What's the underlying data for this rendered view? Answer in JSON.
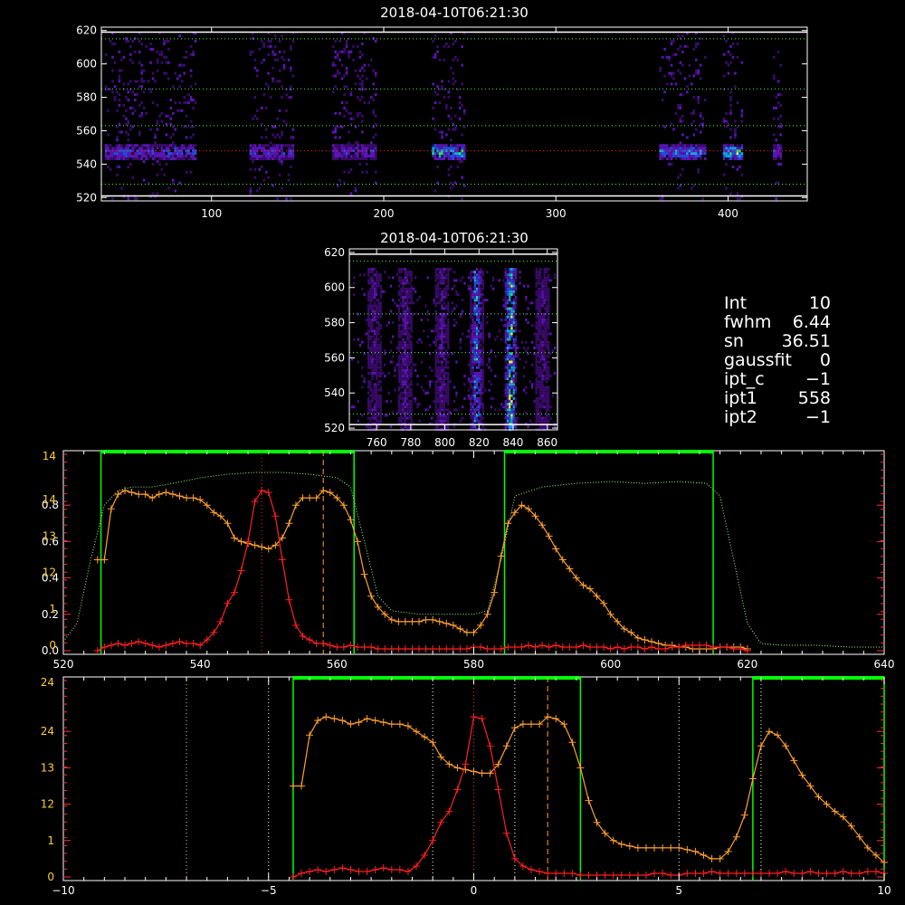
{
  "colors": {
    "background": "#000000",
    "axis": "#ffffff",
    "red_trace": "#ff2020",
    "orange_trace": "#ffa030",
    "green_box": "#00ff00",
    "light_green_dotted": "#a0ff80",
    "red_tick": "#ff3030",
    "gold_tick": "#ffcc33"
  },
  "info_panel": {
    "lines": [
      {
        "label": "Int",
        "value": "10"
      },
      {
        "label": "fwhm",
        "value": "6.44"
      },
      {
        "label": "sn",
        "value": "36.51"
      },
      {
        "label": "gaussfit",
        "value": "0"
      },
      {
        "label": "ipt_c",
        "value": "−1"
      },
      {
        "label": "ipt1",
        "value": "558"
      },
      {
        "label": "ipt2",
        "value": "−1"
      }
    ]
  },
  "chart_data": [
    {
      "type": "heatmap",
      "title": "2018-04-10T06:21:30",
      "xlabel": "",
      "ylabel": "",
      "xlim": [
        36,
        446
      ],
      "ylim": [
        518,
        622
      ],
      "x_ticks": [
        100,
        200,
        300,
        400
      ],
      "y_ticks": [
        520,
        540,
        560,
        580,
        600,
        620
      ],
      "colormap": "dark-purple-blue-green-yellow",
      "reference_lines_y": [
        {
          "y": 548,
          "style": "red-dotted"
        },
        {
          "y": 528,
          "style": "green-dotted"
        },
        {
          "y": 563,
          "style": "green-dotted"
        },
        {
          "y": 585,
          "style": "green-dotted"
        },
        {
          "y": 615,
          "style": "green-dotted"
        }
      ],
      "bands": [
        {
          "x": [
            38,
            90
          ],
          "core": 548,
          "intensity": 0.55
        },
        {
          "x": [
            122,
            148
          ],
          "core": 548,
          "intensity": 0.5
        },
        {
          "x": [
            170,
            195
          ],
          "core": 548,
          "intensity": 0.45
        },
        {
          "x": [
            228,
            247
          ],
          "core": 548,
          "intensity": 0.8
        },
        {
          "x": [
            360,
            387
          ],
          "core": 548,
          "intensity": 0.65
        },
        {
          "x": [
            397,
            408
          ],
          "core": 548,
          "intensity": 0.85
        },
        {
          "x": [
            426,
            430
          ],
          "core": 548,
          "intensity": 0.5
        }
      ]
    },
    {
      "type": "heatmap",
      "title": "2018-04-10T06:21:30",
      "xlabel": "",
      "ylabel": "",
      "xlim": [
        744,
        866
      ],
      "ylim": [
        519,
        622
      ],
      "x_ticks": [
        760,
        780,
        800,
        820,
        840,
        860
      ],
      "y_ticks": [
        520,
        540,
        560,
        580,
        600,
        620
      ],
      "colormap": "dark-purple-blue-green-yellow",
      "reference_lines_y": [
        {
          "y": 615,
          "style": "green-dotted"
        },
        {
          "y": 585,
          "style": "green-dotted"
        },
        {
          "y": 563,
          "style": "green-dotted"
        },
        {
          "y": 528,
          "style": "green-dotted"
        }
      ],
      "streaks": [
        {
          "x": 758,
          "intensity": 0.3
        },
        {
          "x": 776,
          "intensity": 0.35
        },
        {
          "x": 798,
          "intensity": 0.35
        },
        {
          "x": 818,
          "intensity": 0.7
        },
        {
          "x": 838,
          "intensity": 0.9
        },
        {
          "x": 857,
          "intensity": 0.3
        }
      ]
    },
    {
      "type": "line",
      "title": "",
      "xlabel": "",
      "ylabel": "",
      "xlim": [
        520,
        640
      ],
      "ylim": [
        0,
        1.0
      ],
      "left_ticks_white": [
        "0.0",
        "0.2",
        "0.4",
        "0.6",
        "0.8"
      ],
      "left_ticks_red": [
        "0",
        "1",
        "12",
        "13",
        "14"
      ],
      "x_ticks": [
        520,
        540,
        560,
        580,
        600,
        620,
        640
      ],
      "green_boxes": [
        [
          525.5,
          562.5
        ],
        [
          584.5,
          615.0
        ]
      ],
      "vertical_markers": [
        {
          "x": 549.0,
          "style": "red-dotted"
        },
        {
          "x": 558.0,
          "style": "orange-dashed"
        }
      ],
      "series": [
        {
          "style": "light-green-dotted",
          "x": [
            520,
            522,
            524,
            526,
            528,
            530,
            533,
            536,
            540,
            544,
            548,
            552,
            556,
            560,
            562,
            564,
            566,
            568,
            572,
            576,
            580,
            582,
            584,
            586,
            590,
            595,
            600,
            605,
            610,
            614,
            616,
            618,
            620,
            622,
            625,
            630,
            635,
            640
          ],
          "y": [
            0.05,
            0.15,
            0.5,
            0.8,
            0.88,
            0.9,
            0.9,
            0.92,
            0.95,
            0.97,
            0.98,
            0.98,
            0.97,
            0.95,
            0.9,
            0.6,
            0.3,
            0.22,
            0.2,
            0.2,
            0.2,
            0.22,
            0.5,
            0.85,
            0.9,
            0.92,
            0.93,
            0.92,
            0.93,
            0.92,
            0.85,
            0.5,
            0.15,
            0.04,
            0.03,
            0.03,
            0.02,
            0.02
          ]
        },
        {
          "style": "orange-plus",
          "x": [
            525,
            526,
            527,
            528,
            529,
            530,
            531,
            532,
            533,
            534,
            535,
            536,
            537,
            538,
            539,
            540,
            541,
            542,
            543,
            544,
            545,
            546,
            547,
            548,
            549,
            550,
            551,
            552,
            553,
            554,
            555,
            556,
            557,
            558,
            559,
            560,
            561,
            562,
            563,
            564,
            565,
            566,
            567,
            568,
            569,
            570,
            571,
            572,
            573,
            574,
            575,
            576,
            577,
            578,
            579,
            580,
            581,
            582,
            583,
            584,
            585,
            586,
            587,
            588,
            589,
            590,
            591,
            592,
            593,
            594,
            595,
            596,
            597,
            598,
            599,
            600,
            601,
            602,
            603,
            604,
            605,
            606,
            607,
            608,
            609,
            610,
            611,
            612,
            613,
            614,
            615,
            616,
            617,
            618,
            619,
            620
          ],
          "y": [
            0.5,
            0.5,
            0.78,
            0.86,
            0.88,
            0.87,
            0.86,
            0.86,
            0.84,
            0.86,
            0.87,
            0.86,
            0.85,
            0.84,
            0.84,
            0.83,
            0.8,
            0.76,
            0.74,
            0.7,
            0.62,
            0.6,
            0.59,
            0.58,
            0.57,
            0.56,
            0.58,
            0.62,
            0.7,
            0.8,
            0.84,
            0.84,
            0.84,
            0.88,
            0.87,
            0.84,
            0.8,
            0.72,
            0.6,
            0.42,
            0.3,
            0.24,
            0.2,
            0.17,
            0.16,
            0.16,
            0.16,
            0.16,
            0.17,
            0.17,
            0.16,
            0.15,
            0.14,
            0.12,
            0.1,
            0.1,
            0.14,
            0.2,
            0.32,
            0.52,
            0.7,
            0.76,
            0.8,
            0.78,
            0.74,
            0.69,
            0.63,
            0.56,
            0.5,
            0.45,
            0.4,
            0.36,
            0.34,
            0.3,
            0.26,
            0.2,
            0.16,
            0.12,
            0.1,
            0.07,
            0.06,
            0.05,
            0.04,
            0.03,
            0.03,
            0.02,
            0.02,
            0.01,
            0.01,
            0.01,
            0.01,
            0.02,
            0.02,
            0.02,
            0.02,
            0.01
          ]
        },
        {
          "style": "red-plus",
          "x": [
            525,
            526,
            527,
            528,
            529,
            530,
            531,
            532,
            533,
            534,
            535,
            536,
            537,
            538,
            539,
            540,
            541,
            542,
            543,
            544,
            545,
            546,
            547,
            548,
            549,
            550,
            551,
            552,
            553,
            554,
            555,
            556,
            557,
            558,
            559,
            560,
            561,
            562,
            563,
            564,
            565,
            566,
            567,
            568,
            569,
            570,
            571,
            572,
            573,
            574,
            575,
            576,
            577,
            578,
            579,
            580,
            581,
            582,
            583,
            584,
            585,
            586,
            587,
            588,
            589,
            590,
            591,
            592,
            593,
            594,
            595,
            596,
            597,
            598,
            599,
            600,
            601,
            602,
            603,
            604,
            605,
            606,
            607,
            608,
            609,
            610,
            611,
            612,
            613,
            614,
            615,
            616,
            617,
            618,
            619,
            620
          ],
          "y": [
            0.0,
            0.02,
            0.03,
            0.04,
            0.03,
            0.04,
            0.05,
            0.04,
            0.03,
            0.02,
            0.03,
            0.04,
            0.05,
            0.04,
            0.04,
            0.03,
            0.06,
            0.1,
            0.16,
            0.26,
            0.32,
            0.44,
            0.6,
            0.82,
            0.88,
            0.87,
            0.74,
            0.5,
            0.28,
            0.14,
            0.08,
            0.06,
            0.04,
            0.04,
            0.03,
            0.02,
            0.02,
            0.03,
            0.02,
            0.02,
            0.02,
            0.01,
            0.01,
            0.01,
            0.01,
            0.01,
            0.01,
            0.01,
            0.01,
            0.01,
            0.01,
            0.01,
            0.01,
            0.01,
            0.01,
            0.02,
            0.02,
            0.01,
            0.01,
            0.01,
            0.02,
            0.02,
            0.02,
            0.03,
            0.02,
            0.03,
            0.02,
            0.03,
            0.02,
            0.02,
            0.02,
            0.03,
            0.02,
            0.02,
            0.02,
            0.01,
            0.02,
            0.01,
            0.02,
            0.02,
            0.01,
            0.02,
            0.01,
            0.01,
            0.02,
            0.02,
            0.03,
            0.03,
            0.03,
            0.03,
            0.02,
            0.02,
            0.02,
            0.01,
            0.01,
            0.0
          ]
        }
      ]
    },
    {
      "type": "line",
      "title": "",
      "xlabel": "",
      "ylabel": "",
      "xlim": [
        -10,
        10
      ],
      "ylim": [
        0,
        1.0
      ],
      "left_ticks_red": [
        "0",
        "1",
        "12",
        "13",
        "24"
      ],
      "x_ticks": [
        -10,
        -5,
        0,
        5,
        10
      ],
      "green_boxes": [
        [
          -4.4,
          2.6
        ],
        [
          6.8,
          10.0
        ]
      ],
      "vertical_markers": [
        {
          "x": 0.0,
          "style": "red-dotted"
        },
        {
          "x": 1.8,
          "style": "orange-dashed"
        },
        {
          "x": -7.0,
          "style": "gold-dotted"
        },
        {
          "x": -5.0,
          "style": "white-dotted"
        },
        {
          "x": -1.0,
          "style": "white-dotted"
        },
        {
          "x": 1.0,
          "style": "white-dotted"
        },
        {
          "x": 5.0,
          "style": "white-dotted"
        },
        {
          "x": 7.0,
          "style": "white-dotted"
        }
      ],
      "series": [
        {
          "style": "orange-plus",
          "x": [
            -4.4,
            -4.2,
            -4.0,
            -3.8,
            -3.6,
            -3.4,
            -3.2,
            -3.0,
            -2.8,
            -2.6,
            -2.4,
            -2.2,
            -2.0,
            -1.8,
            -1.6,
            -1.4,
            -1.2,
            -1.0,
            -0.8,
            -0.6,
            -0.4,
            -0.2,
            0.0,
            0.2,
            0.4,
            0.6,
            0.8,
            1.0,
            1.2,
            1.4,
            1.6,
            1.8,
            2.0,
            2.2,
            2.4,
            2.6,
            2.8,
            3.0,
            3.2,
            3.4,
            3.6,
            3.8,
            4.0,
            4.2,
            4.4,
            4.6,
            4.8,
            5.0,
            5.2,
            5.4,
            5.6,
            5.8,
            6.0,
            6.2,
            6.4,
            6.6,
            6.8,
            7.0,
            7.2,
            7.4,
            7.6,
            7.8,
            8.0,
            8.2,
            8.4,
            8.6,
            8.8,
            9.0,
            9.2,
            9.4,
            9.6,
            9.8,
            10.0
          ],
          "y": [
            0.5,
            0.5,
            0.78,
            0.86,
            0.88,
            0.87,
            0.86,
            0.84,
            0.85,
            0.87,
            0.86,
            0.85,
            0.84,
            0.84,
            0.83,
            0.8,
            0.77,
            0.74,
            0.66,
            0.62,
            0.6,
            0.59,
            0.58,
            0.57,
            0.57,
            0.62,
            0.72,
            0.82,
            0.84,
            0.84,
            0.84,
            0.88,
            0.87,
            0.84,
            0.74,
            0.6,
            0.42,
            0.3,
            0.24,
            0.2,
            0.18,
            0.17,
            0.16,
            0.16,
            0.16,
            0.16,
            0.16,
            0.16,
            0.15,
            0.14,
            0.12,
            0.1,
            0.1,
            0.14,
            0.22,
            0.34,
            0.54,
            0.72,
            0.8,
            0.78,
            0.72,
            0.64,
            0.56,
            0.5,
            0.44,
            0.4,
            0.36,
            0.33,
            0.28,
            0.22,
            0.16,
            0.12,
            0.08
          ]
        },
        {
          "style": "red-plus",
          "x": [
            -4.4,
            -4.2,
            -4.0,
            -3.8,
            -3.6,
            -3.4,
            -3.2,
            -3.0,
            -2.8,
            -2.6,
            -2.4,
            -2.2,
            -2.0,
            -1.8,
            -1.6,
            -1.4,
            -1.2,
            -1.0,
            -0.8,
            -0.6,
            -0.4,
            -0.2,
            0.0,
            0.2,
            0.4,
            0.6,
            0.8,
            1.0,
            1.2,
            1.4,
            1.6,
            1.8,
            2.0,
            2.2,
            2.4,
            2.6,
            2.8,
            3.0,
            3.2,
            3.4,
            3.6,
            3.8,
            4.0,
            4.2,
            4.4,
            4.6,
            4.8,
            5.0,
            5.2,
            5.4,
            5.6,
            5.8,
            6.0,
            6.2,
            6.4,
            6.6,
            6.8,
            7.0,
            7.2,
            7.4,
            7.6,
            7.8,
            8.0,
            8.2,
            8.4,
            8.6,
            8.8,
            9.0,
            9.2,
            9.4,
            9.6,
            9.8,
            10.0
          ],
          "y": [
            0.0,
            0.02,
            0.03,
            0.04,
            0.03,
            0.04,
            0.05,
            0.04,
            0.03,
            0.03,
            0.04,
            0.05,
            0.04,
            0.04,
            0.03,
            0.06,
            0.12,
            0.2,
            0.3,
            0.36,
            0.48,
            0.62,
            0.88,
            0.87,
            0.72,
            0.48,
            0.24,
            0.1,
            0.06,
            0.04,
            0.03,
            0.02,
            0.02,
            0.02,
            0.02,
            0.01,
            0.01,
            0.01,
            0.01,
            0.01,
            0.01,
            0.01,
            0.01,
            0.01,
            0.02,
            0.02,
            0.01,
            0.01,
            0.02,
            0.02,
            0.02,
            0.03,
            0.02,
            0.02,
            0.02,
            0.02,
            0.02,
            0.02,
            0.02,
            0.02,
            0.03,
            0.02,
            0.02,
            0.03,
            0.02,
            0.02,
            0.02,
            0.03,
            0.02,
            0.02,
            0.03,
            0.03,
            0.02
          ]
        }
      ]
    }
  ]
}
